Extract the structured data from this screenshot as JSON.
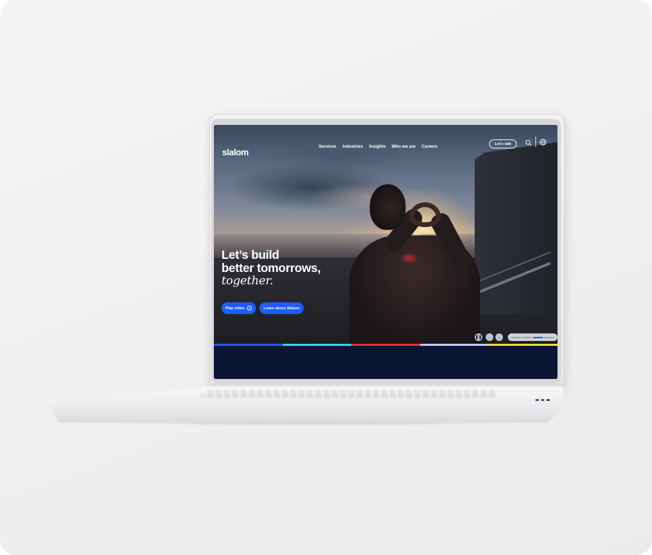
{
  "site": {
    "logo": "slalom",
    "nav": [
      "Services",
      "Industries",
      "Insights",
      "Who we are",
      "Careers"
    ],
    "cta": "Let's talk",
    "icons": {
      "search": "search-icon",
      "language": "globe-icon"
    }
  },
  "hero": {
    "headline_line1": "Let’s build",
    "headline_line2": "better tomorrows,",
    "headline_line3": "together.",
    "play_button": "Play video",
    "learn_button": "Learn about Slalom"
  },
  "carousel": {
    "progress_segments": 4,
    "active_segment": 2
  },
  "colors": {
    "accent": "#1f5cff",
    "band": [
      "#2a4fff",
      "#38d4e6",
      "#e0342f",
      "#c9c6ff",
      "#e9e12f"
    ],
    "footer_bg": "#0b1634"
  }
}
